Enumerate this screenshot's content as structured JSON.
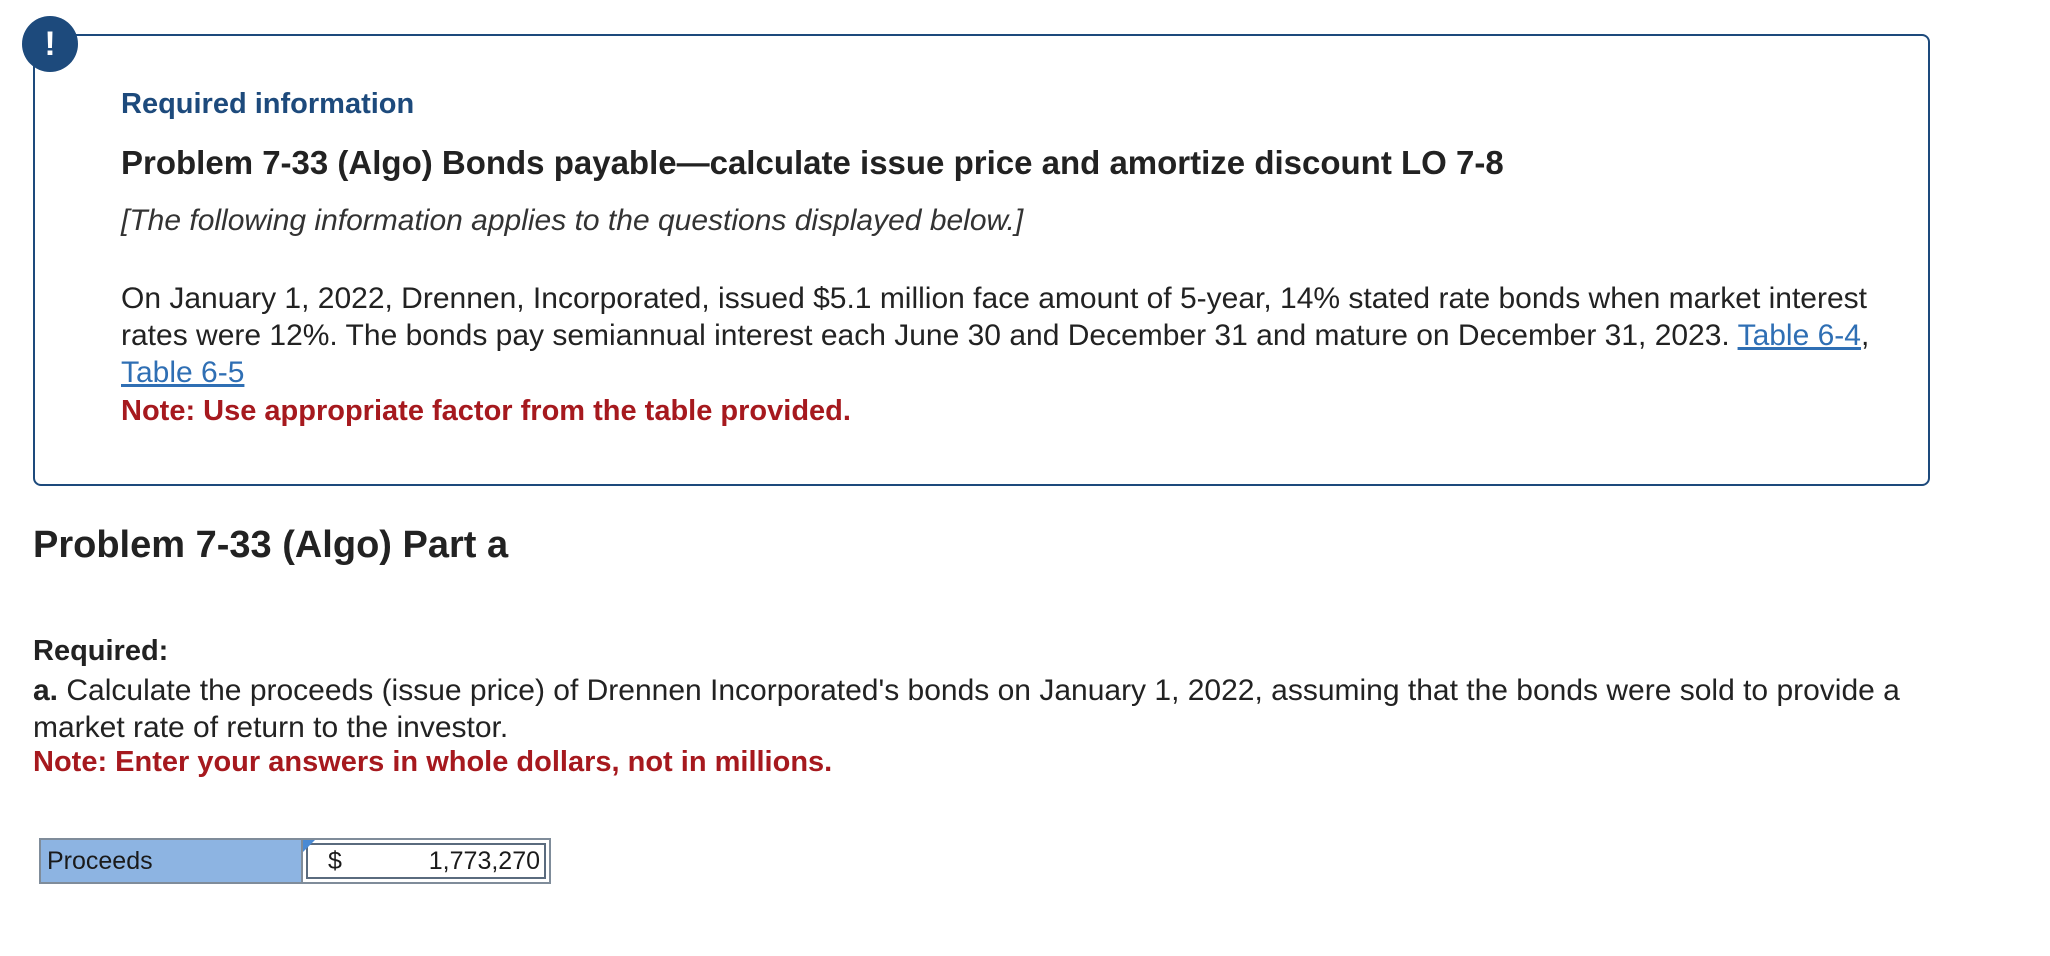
{
  "alert": {
    "icon": "exclamation-icon",
    "glyph": "!",
    "color": "#1d4a7c"
  },
  "info_box": {
    "title": "Required information",
    "problem_heading": "Problem 7-33 (Algo) Bonds payable—calculate issue price and amortize discount LO 7-8",
    "applies_note": "[The following information applies to the questions displayed below.]",
    "paragraph_text": "On January 1, 2022, Drennen, Incorporated, issued $5.1 million face amount of 5-year, 14% stated rate bonds when market interest rates were 12%. The bonds pay semiannual interest each June 30 and December 31 and mature on December 31, 2023.",
    "link_1": "Table 6-4",
    "separator": ",",
    "link_2": "Table 6-5",
    "note": "Note: Use appropriate factor from the table provided."
  },
  "part": {
    "heading": "Problem 7-33 (Algo) Part a",
    "required_label": "Required:",
    "question_letter": "a.",
    "question_text": "Calculate the proceeds (issue price) of Drennen Incorporated's bonds on January 1, 2022, assuming that the bonds were sold to provide a market rate of return to the investor.",
    "note": "Note: Enter your answers in whole dollars, not in millions."
  },
  "answer": {
    "label": "Proceeds",
    "currency": "$",
    "value": "1,773,270"
  },
  "colors": {
    "accent": "#1d4a7c",
    "link": "#2f6fb4",
    "note_red": "#a6191e",
    "label_fill": "#8db4e2"
  }
}
